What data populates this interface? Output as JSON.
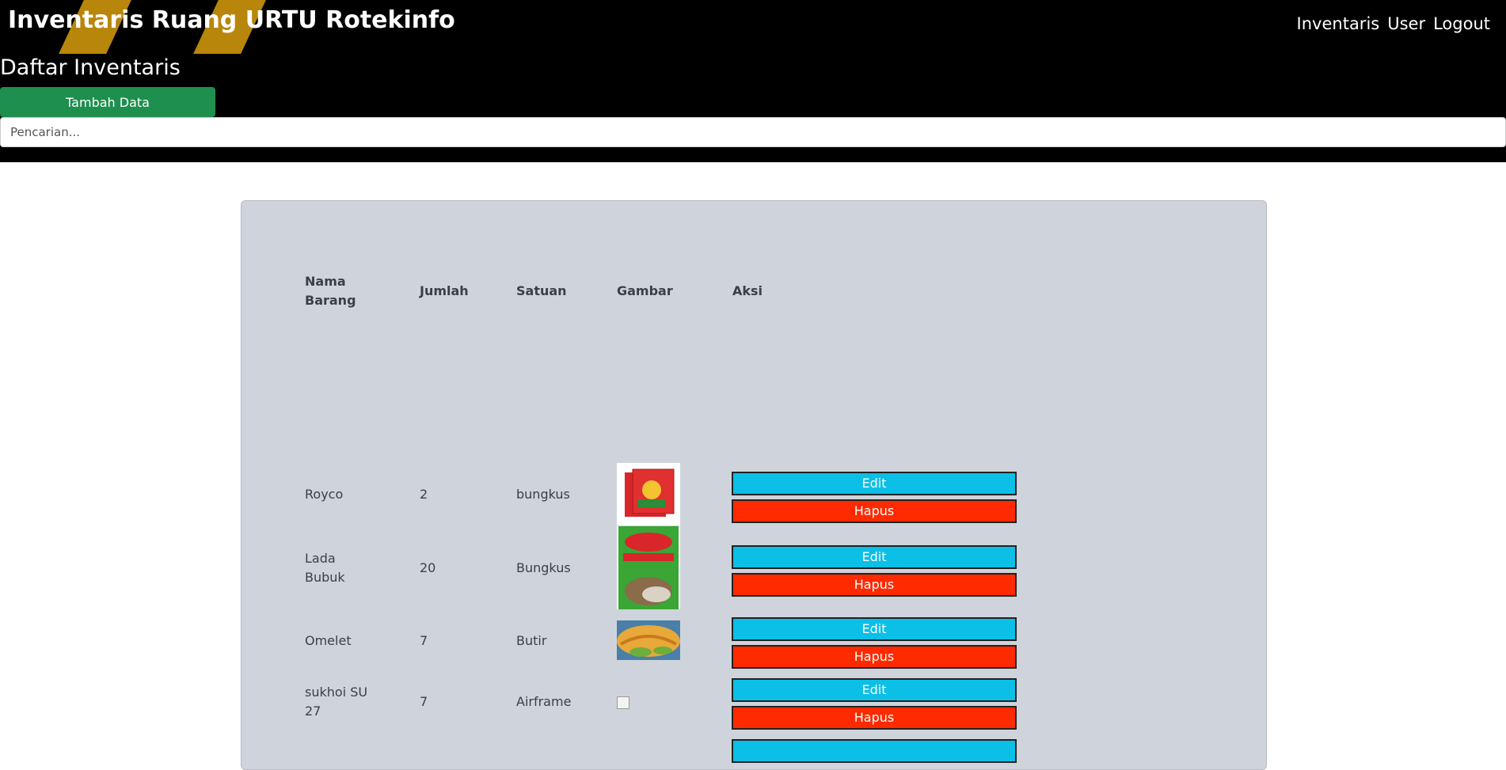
{
  "header": {
    "brand": "Inventaris Ruang URTU Rotekinfo",
    "nav": [
      "Inventaris",
      "User",
      "Logout"
    ],
    "title": "Daftar Inventaris",
    "add_button": "Tambah Data",
    "search_placeholder": "Pencarian..."
  },
  "table": {
    "columns": [
      "Nama Barang",
      "Jumlah",
      "Satuan",
      "Gambar",
      "Aksi"
    ],
    "edit_label": "Edit",
    "delete_label": "Hapus",
    "rows": [
      {
        "name": "Royco",
        "qty": "2",
        "unit": "bungkus",
        "image": "royco-packet"
      },
      {
        "name": "Lada Bubuk",
        "qty": "20",
        "unit": "Bungkus",
        "image": "ladaku-pepper-packet"
      },
      {
        "name": "Omelet",
        "qty": "7",
        "unit": "Butir",
        "image": "omelet-photo"
      },
      {
        "name": "sukhoi SU 27",
        "qty": "7",
        "unit": "Airframe",
        "image": "broken-image"
      }
    ]
  },
  "colors": {
    "header_bg": "#000000",
    "add_button": "#1e8f4e",
    "edit_button": "#0bbfe6",
    "delete_button": "#ff2a00",
    "card_bg": "#cfd4dc"
  }
}
